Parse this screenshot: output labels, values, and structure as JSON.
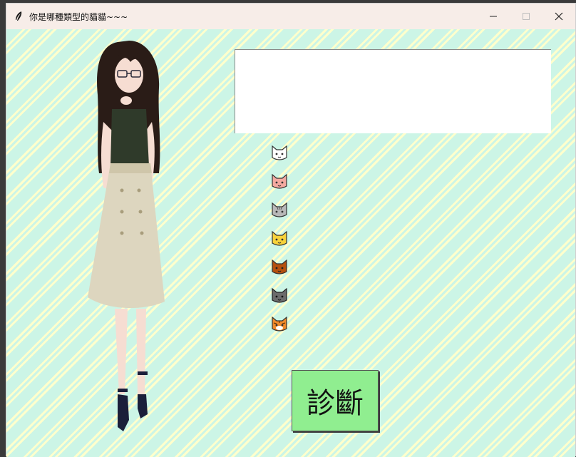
{
  "window": {
    "title": "你是哪種類型的貓貓~~~",
    "icons": {
      "app": "feather-icon",
      "minimize": "minimize-icon",
      "maximize": "maximize-icon",
      "close": "close-icon"
    }
  },
  "main": {
    "illustration": "girl-illustration",
    "result_text": "",
    "cats": [
      {
        "name": "white-cat-icon",
        "color": "#ffffff"
      },
      {
        "name": "pink-cat-icon",
        "color": "#f4a9a0"
      },
      {
        "name": "gray-tabby-cat-icon",
        "color": "#b8b8b8"
      },
      {
        "name": "yellow-cat-icon",
        "color": "#f7d23a"
      },
      {
        "name": "brown-cat-icon",
        "color": "#b5500e"
      },
      {
        "name": "dark-gray-cat-icon",
        "color": "#6b6b6b"
      },
      {
        "name": "orange-tiger-cat-icon",
        "color": "#f08a2a"
      }
    ],
    "diagnose_label": "診斷"
  },
  "colors": {
    "background_stripe_a": "#ccf5e6",
    "background_stripe_b": "#ffffcc",
    "button": "#90ee90"
  }
}
